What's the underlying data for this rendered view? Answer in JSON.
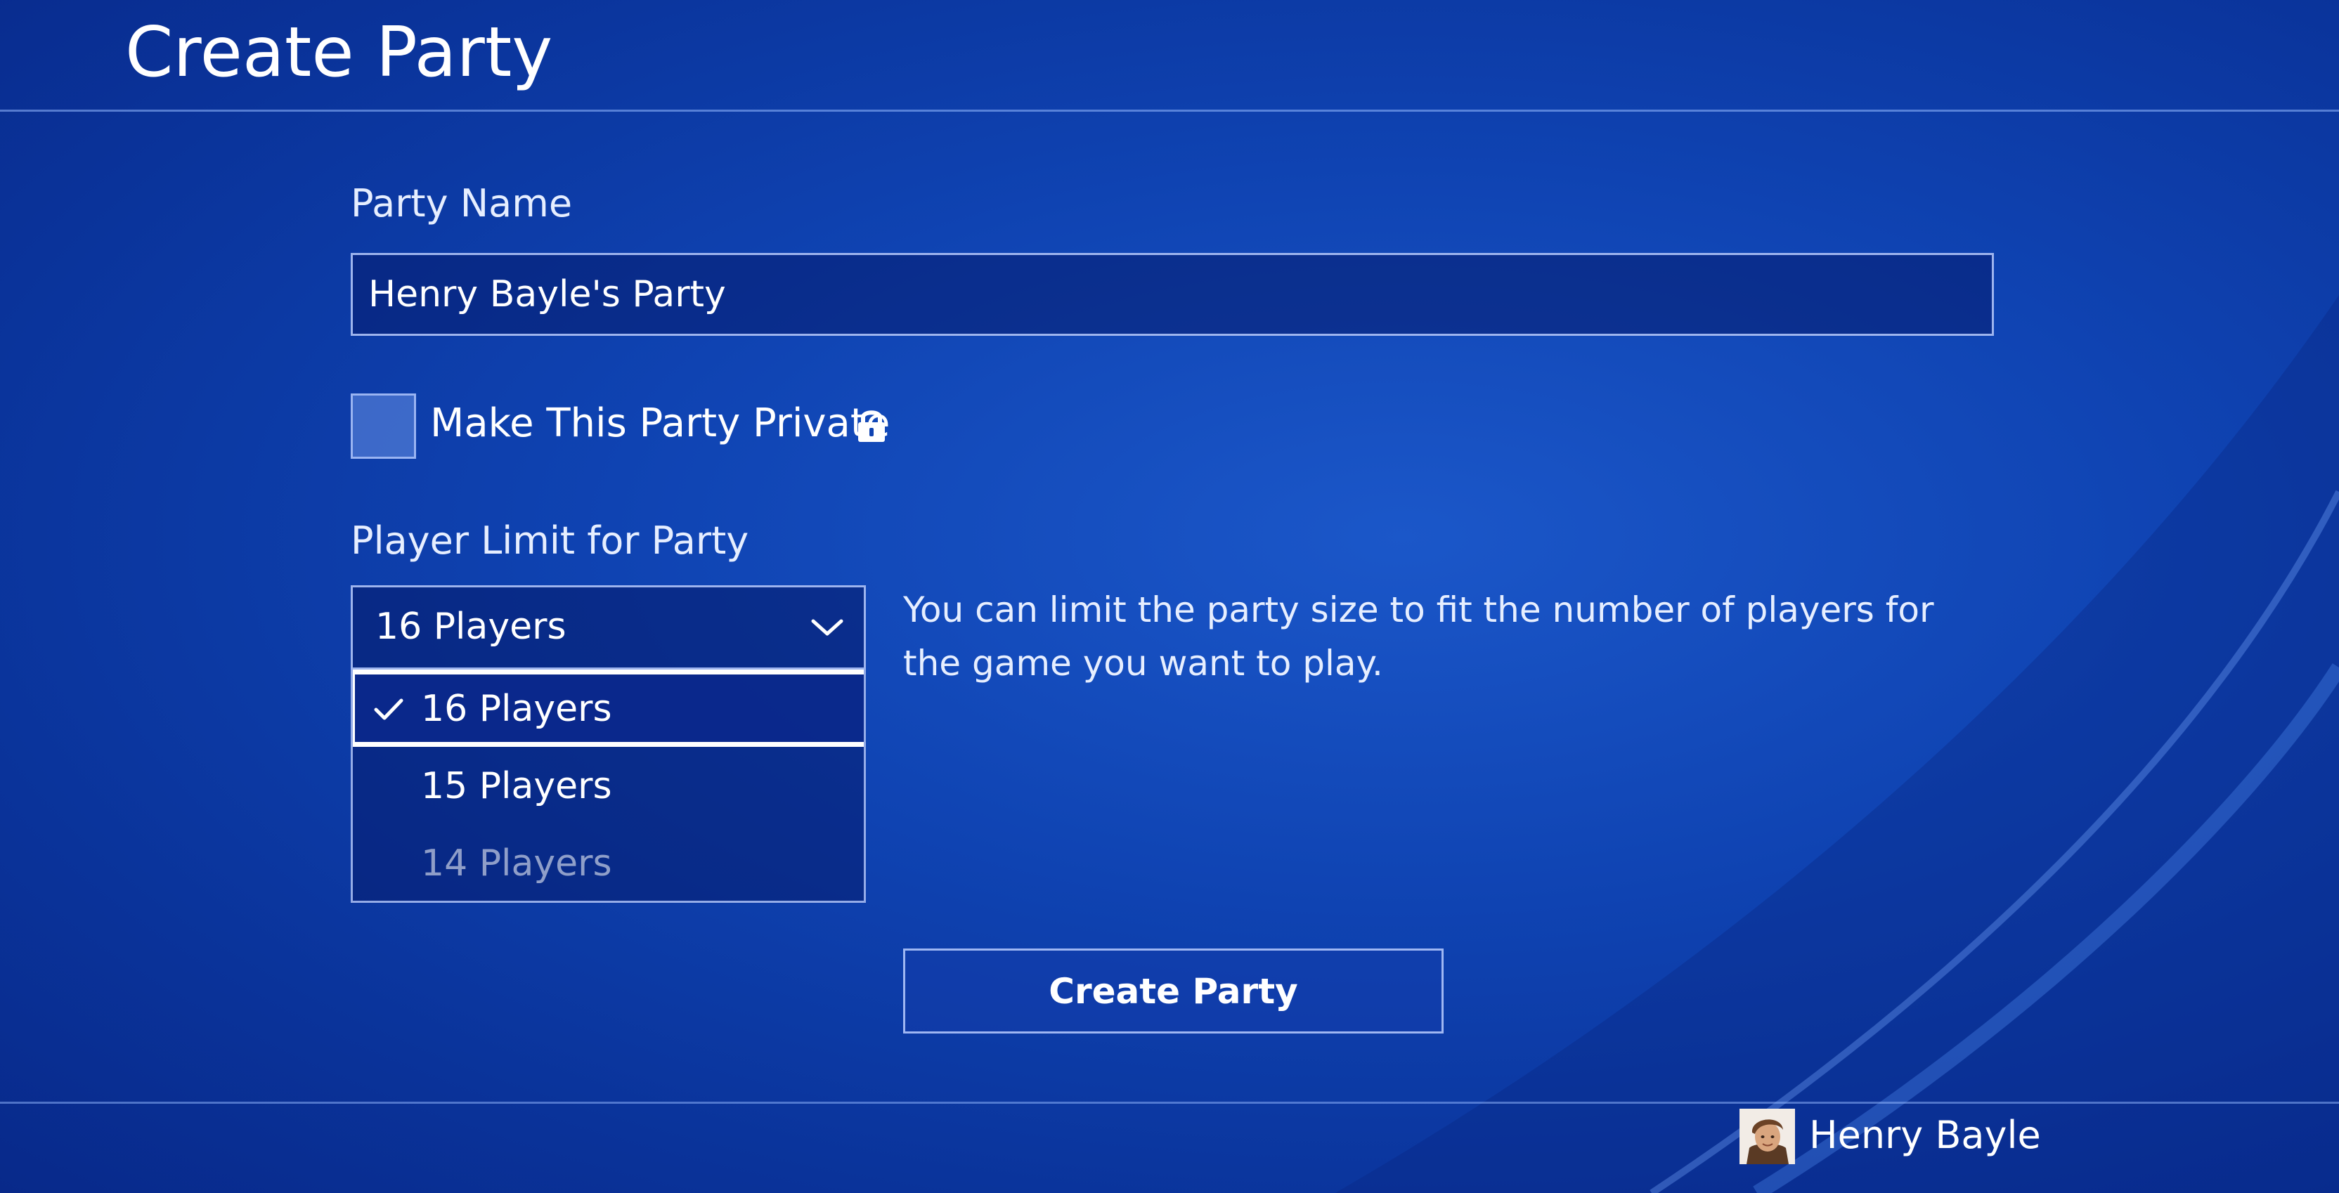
{
  "header": {
    "title": "Create Party"
  },
  "form": {
    "party_name_label": "Party Name",
    "party_name_value": "Henry Bayle's Party",
    "private_label": "Make This Party Private",
    "private_checked": false,
    "player_limit_label": "Player Limit for Party",
    "player_limit_selected": "16 Players",
    "player_limit_options": [
      "16 Players",
      "15 Players",
      "14 Players"
    ],
    "help_text": "You can limit the party size to fit the number of players for the game you want to play.",
    "create_button_label": "Create Party"
  },
  "footer": {
    "user_name": "Henry Bayle"
  },
  "icons": {
    "lock": "lock-icon",
    "chevron": "chevron-down-icon",
    "check": "check-icon",
    "avatar": "avatar"
  },
  "colors": {
    "background": "#0b3aa3",
    "text": "#ffffff",
    "border": "#b9cdff",
    "focus": "#ffffff"
  }
}
